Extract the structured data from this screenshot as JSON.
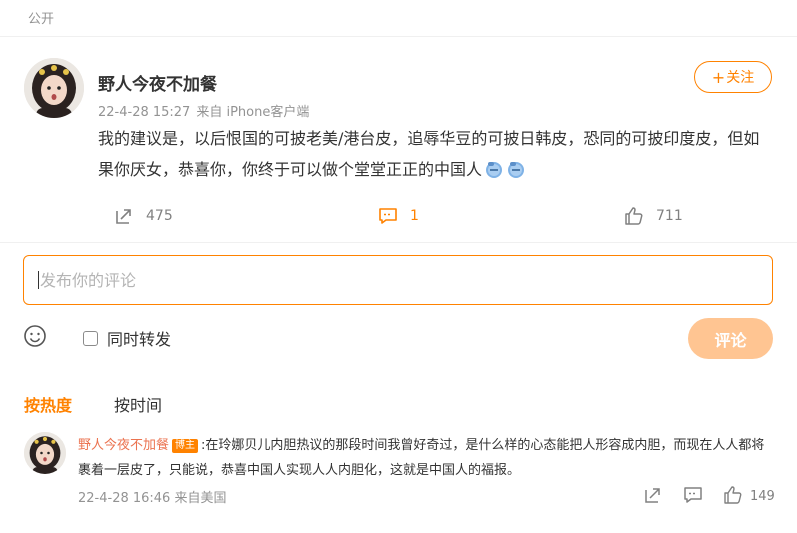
{
  "visibility": "公开",
  "post": {
    "author": "野人今夜不加餐",
    "time": "22-4-28 15:27",
    "source": "来自 iPhone客户端",
    "follow_label": "关注",
    "content": "我的建议是，以后恨国的可披老美/港台皮，追辱华豆的可披日韩皮，恐同的可披印度皮，但如果你厌女，恭喜你，你终于可以做个堂堂正正的中国人",
    "actions": {
      "repost_count": "475",
      "comment_count": "1",
      "like_count": "711"
    }
  },
  "composer": {
    "placeholder": "发布你的评论",
    "repost_label": "同时转发",
    "submit_label": "评论"
  },
  "sort": {
    "hot_label": "按热度",
    "time_label": "按时间"
  },
  "comment": {
    "author": "野人今夜不加餐",
    "badge": "博主",
    "text": ":在玲娜贝儿内胆热议的那段时间我曾好奇过，是什么样的心态能把人形容成内胆，而现在人人都将裹着一层皮了，只能说，恭喜中国人实现人人内胆化，这就是中国人的福报。",
    "meta": "22-4-28 16:46 来自美国",
    "like_count": "149"
  },
  "colors": {
    "accent": "#ff8200",
    "name_link": "#eb7350",
    "submit_disabled": "#ffc592"
  }
}
